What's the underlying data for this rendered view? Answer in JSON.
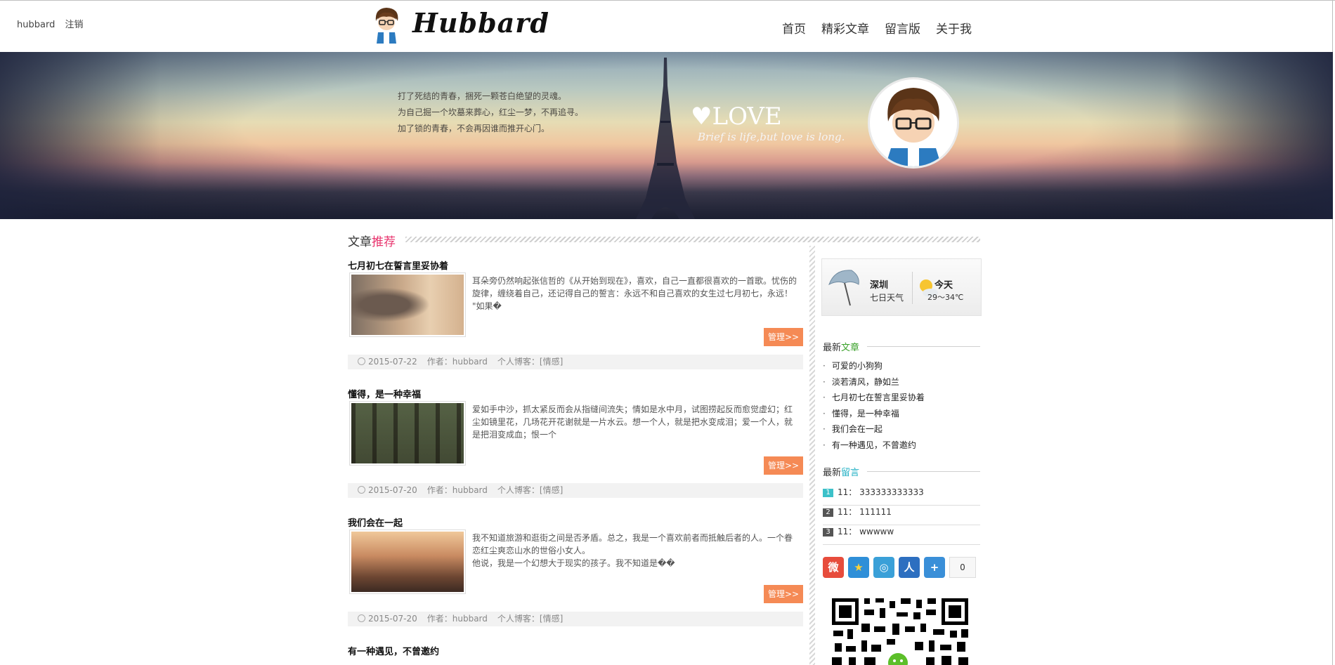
{
  "header": {
    "user_name": "hubbard",
    "logout_label": "注销",
    "logo_text": "Hubbard",
    "nav": [
      "首页",
      "精彩文章",
      "留言版",
      "关于我"
    ]
  },
  "banner": {
    "poem": [
      "打了死结的青春，捆死一颗苍白绝望的灵魂。",
      "为自己掘一个坎墓来葬心，红尘一梦，不再追寻。",
      "加了锁的青春，不会再因谁而推开心门。"
    ],
    "love_title": "LOVE",
    "love_sub": "Brief is life,but love is long."
  },
  "section": {
    "title_a": "文章",
    "title_b": "推荐"
  },
  "articles": [
    {
      "title": "七月初七在誓言里妥协着",
      "body": "耳朵旁仍然响起张信哲的《从开始到现在》，喜欢，自己一直都很喜欢的一首歌。忧伤的旋律，缠绕着自己，还记得自己的誓言：永远不和自己喜欢的女生过七月初七，永远！     \"如果�",
      "button": "管理>>",
      "date": "2015-07-22",
      "author": "作者：hubbard",
      "blog": "个人博客：[情感]"
    },
    {
      "title": "懂得，是一种幸福",
      "body": "爱如手中沙，抓太紧反而会从指缝间流失；情如是水中月，试图捞起反而愈觉虚幻；红尘如镜里花，几场花开花谢就是一片水云。想一个人，就是把水变成泪；爱一个人，就是把泪变成血；恨一个",
      "button": "管理>>",
      "date": "2015-07-20",
      "author": "作者：hubbard",
      "blog": "个人博客：[情感]"
    },
    {
      "title": "我们会在一起",
      "body": "  我不知道旅游和逛街之间是否矛盾。总之，我是一个喜欢前者而抵触后者的人。一个眷恋红尘爽恋山水的世俗小女人。\n  他说，我是一个幻想大于现实的孩子。我不知道是��",
      "button": "管理>>",
      "date": "2015-07-20",
      "author": "作者：hubbard",
      "blog": "个人博客：[情感]"
    },
    {
      "title": "有一种遇见，不曾邀约"
    }
  ],
  "weather": {
    "city": "深圳",
    "sub": "七日天气",
    "today": "今天",
    "temp": "29～34℃"
  },
  "latest_articles": {
    "title_a": "最新",
    "title_b": "文章",
    "items": [
      "可爱的小狗狗",
      "淡若清风，静如兰",
      "七月初七在誓言里妥协着",
      "懂得，是一种幸福",
      "我们会在一起",
      "有一种遇见，不曾邀约"
    ]
  },
  "latest_messages": {
    "title_a": "最新",
    "title_b": "留言",
    "items": [
      {
        "num": "1",
        "user": "11：",
        "text": "333333333333",
        "color": "#3cc1c9"
      },
      {
        "num": "2",
        "user": "11：",
        "text": "111111",
        "color": "#555555"
      },
      {
        "num": "3",
        "user": "11：",
        "text": "wwwww",
        "color": "#555555"
      }
    ]
  },
  "share": {
    "count": "0"
  },
  "colors": {
    "accent_pink": "#e8336d",
    "button_orange": "#f58a55",
    "green": "#3aa12a",
    "cyan": "#23b1c5"
  }
}
